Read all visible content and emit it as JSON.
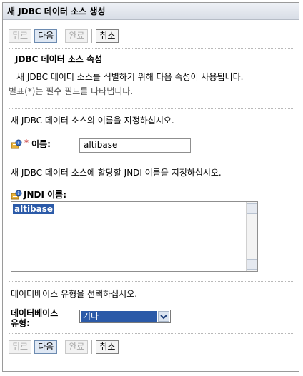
{
  "window": {
    "title": "새 JDBC 데이터 소스 생성"
  },
  "buttons": {
    "back": "뒤로",
    "next": "다음",
    "finish": "완료",
    "cancel": "취소"
  },
  "section": {
    "heading": "JDBC 데이터 소스 속성",
    "description": "새 JDBC 데이터 소스를 식별하기 위해 다음 속성이 사용됩니다.",
    "required_note": "별표(*)는 필수 필드를 나타냅니다."
  },
  "name_field": {
    "instruction": "새 JDBC 데이터 소스의 이름을 지정하십시오.",
    "required_mark": "*",
    "label": "이름:",
    "value": "altibase"
  },
  "jndi_field": {
    "instruction": "새 JDBC 데이터 소스에 할당할 JNDI 이름을 지정하십시오.",
    "label": "JNDI 이름:",
    "value": "altibase"
  },
  "db_type": {
    "instruction": "데이터베이스 유형을 선택하십시오.",
    "label_line1": "데이터베이스",
    "label_line2": "유형:",
    "selected": "기타"
  },
  "icons": {
    "info": "info-help-icon",
    "dropdown": "chevron-down-icon",
    "scroll_up": "scroll-up-icon",
    "scroll_down": "scroll-down-icon"
  }
}
